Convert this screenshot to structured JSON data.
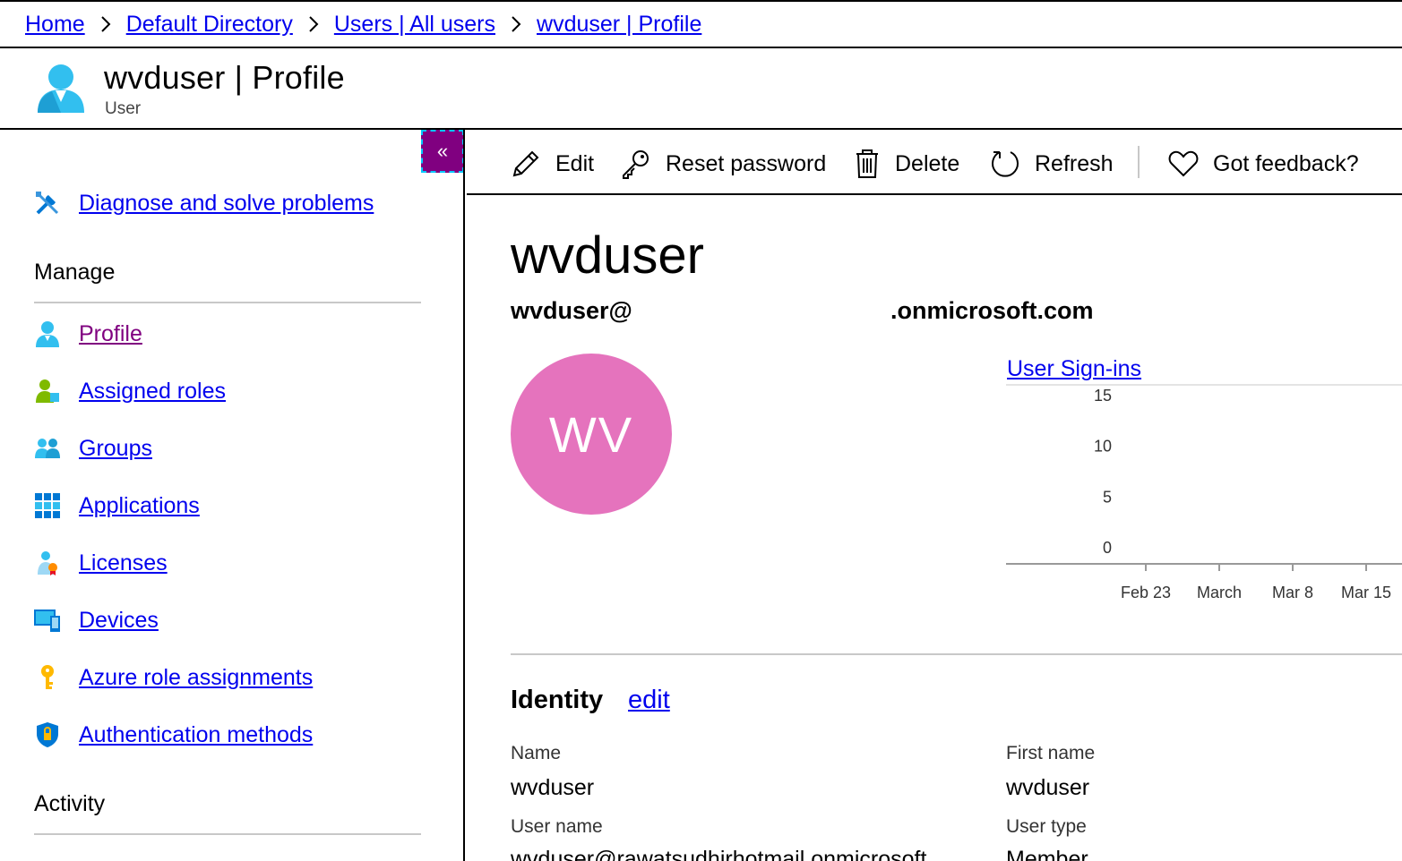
{
  "breadcrumb": {
    "items": [
      "Home",
      "Default Directory",
      "Users | All users",
      "wvduser | Profile"
    ]
  },
  "header": {
    "title": "wvduser | Profile",
    "subtitle": "User"
  },
  "sidebar": {
    "collapse_glyph": "«",
    "top_item": {
      "label": "Diagnose and solve problems",
      "icon": "wrench-screwdriver-icon"
    },
    "manage_title": "Manage",
    "manage_items": [
      {
        "label": "Profile",
        "icon": "user-icon",
        "visited": true
      },
      {
        "label": "Assigned roles",
        "icon": "assigned-roles-icon"
      },
      {
        "label": "Groups",
        "icon": "groups-icon"
      },
      {
        "label": "Applications",
        "icon": "applications-grid-icon"
      },
      {
        "label": "Licenses",
        "icon": "licenses-icon"
      },
      {
        "label": "Devices",
        "icon": "devices-icon"
      },
      {
        "label": "Azure role assignments",
        "icon": "key-icon"
      },
      {
        "label": "Authentication methods",
        "icon": "shield-icon"
      }
    ],
    "activity_title": "Activity"
  },
  "toolbar": {
    "edit": "Edit",
    "reset_password": "Reset password",
    "delete": "Delete",
    "refresh": "Refresh",
    "feedback": "Got feedback?"
  },
  "main": {
    "display_name": "wvduser",
    "upn_prefix": "wvduser@",
    "upn_suffix": ".onmicrosoft.com",
    "avatar_initials": "WV",
    "avatar_color": "#e573bd",
    "identity": {
      "title": "Identity",
      "edit_label": "edit",
      "fields": {
        "name_label": "Name",
        "name_value": "wvduser",
        "first_name_label": "First name",
        "first_name_value": "wvduser",
        "user_name_label": "User name",
        "user_name_value": "wvduser@rawatsudhirhotmail.onmicrosoft",
        "user_type_label": "User type",
        "user_type_value": "Member"
      }
    }
  },
  "chart_data": {
    "type": "line",
    "title": "User Sign-ins",
    "yticks": [
      0,
      5,
      10,
      15
    ],
    "ylim": [
      0,
      15
    ],
    "xticks": [
      "Feb 23",
      "March",
      "Mar 8",
      "Mar 15"
    ],
    "series": []
  }
}
